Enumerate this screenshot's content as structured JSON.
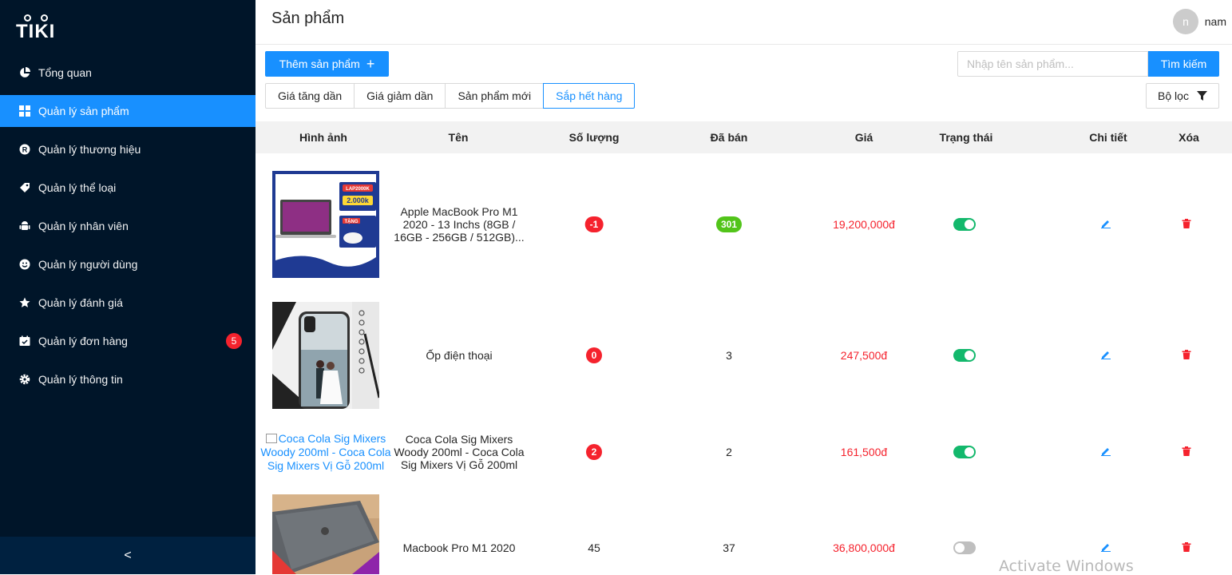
{
  "brand": {
    "logo_text": "TIKI"
  },
  "sidebar": {
    "items": [
      {
        "label": "Tổng quan",
        "icon": "pie-chart-icon",
        "active": false
      },
      {
        "label": "Quản lý sản phẩm",
        "icon": "appstore-icon",
        "active": true
      },
      {
        "label": "Quản lý thương hiệu",
        "icon": "registered-icon",
        "active": false
      },
      {
        "label": "Quản lý thể loại",
        "icon": "tag-icon",
        "active": false
      },
      {
        "label": "Quản lý nhân viên",
        "icon": "android-icon",
        "active": false
      },
      {
        "label": "Quản lý người dùng",
        "icon": "smile-icon",
        "active": false
      },
      {
        "label": "Quản lý đánh giá",
        "icon": "star-icon",
        "active": false
      },
      {
        "label": "Quản lý đơn hàng",
        "icon": "schedule-icon",
        "active": false,
        "badge": "5"
      },
      {
        "label": "Quản lý thông tin",
        "icon": "setting-icon",
        "active": false
      }
    ],
    "collapse_label": "<"
  },
  "header": {
    "title": "Sản phẩm",
    "avatar_initial": "n",
    "username": "nam"
  },
  "toolbar": {
    "add_label": "Thêm sản phẩm",
    "search_placeholder": "Nhập tên sản phẩm...",
    "search_value": "",
    "search_button": "Tìm kiếm",
    "sort_options": [
      "Giá tăng dần",
      "Giá giảm dần",
      "Sản phẩm mới",
      "Sắp hết hàng"
    ],
    "active_sort": "Sắp hết hàng",
    "filter_label": "Bộ lọc"
  },
  "table": {
    "columns": [
      "Hình ảnh",
      "Tên",
      "Số lượng",
      "Đã bán",
      "Giá",
      "Trạng thái",
      "Chi tiết",
      "Xóa"
    ],
    "rows": [
      {
        "image": "macbook-promo",
        "name": "Apple MacBook Pro M1 2020 - 13 Inchs (8GB / 16GB - 256GB / 512GB)...",
        "quantity": "-1",
        "quantity_style": "red-pill",
        "sold": "301",
        "sold_style": "green-pill",
        "price": "19,200,000đ",
        "active": true
      },
      {
        "image": "phone-case",
        "name": "Ốp điện thoại",
        "quantity": "0",
        "quantity_style": "red-pill",
        "sold": "3",
        "sold_style": "plain",
        "price": "247,500đ",
        "active": true
      },
      {
        "image": "broken",
        "image_alt": "Coca Cola Sig Mixers Woody 200ml - Coca Cola Sig Mixers Vị Gỗ 200ml",
        "name": "Coca Cola Sig Mixers Woody 200ml - Coca Cola Sig Mixers Vị Gỗ 200ml",
        "quantity": "2",
        "quantity_style": "red-pill",
        "sold": "2",
        "sold_style": "plain",
        "price": "161,500đ",
        "active": true
      },
      {
        "image": "macbook-photo",
        "name": "Macbook Pro M1 2020",
        "quantity": "45",
        "quantity_style": "plain",
        "sold": "37",
        "sold_style": "plain",
        "price": "36,800,000đ",
        "active": false
      }
    ]
  },
  "promo": {
    "code": "LAP2000K",
    "amount": "2.000k",
    "gift": "TẶNG"
  },
  "watermark": "Activate Windows",
  "colors": {
    "sidebar_bg": "#001529",
    "primary": "#1890ff",
    "danger": "#f5222d",
    "success": "#52c41a",
    "toggle_on": "#13b86c"
  }
}
